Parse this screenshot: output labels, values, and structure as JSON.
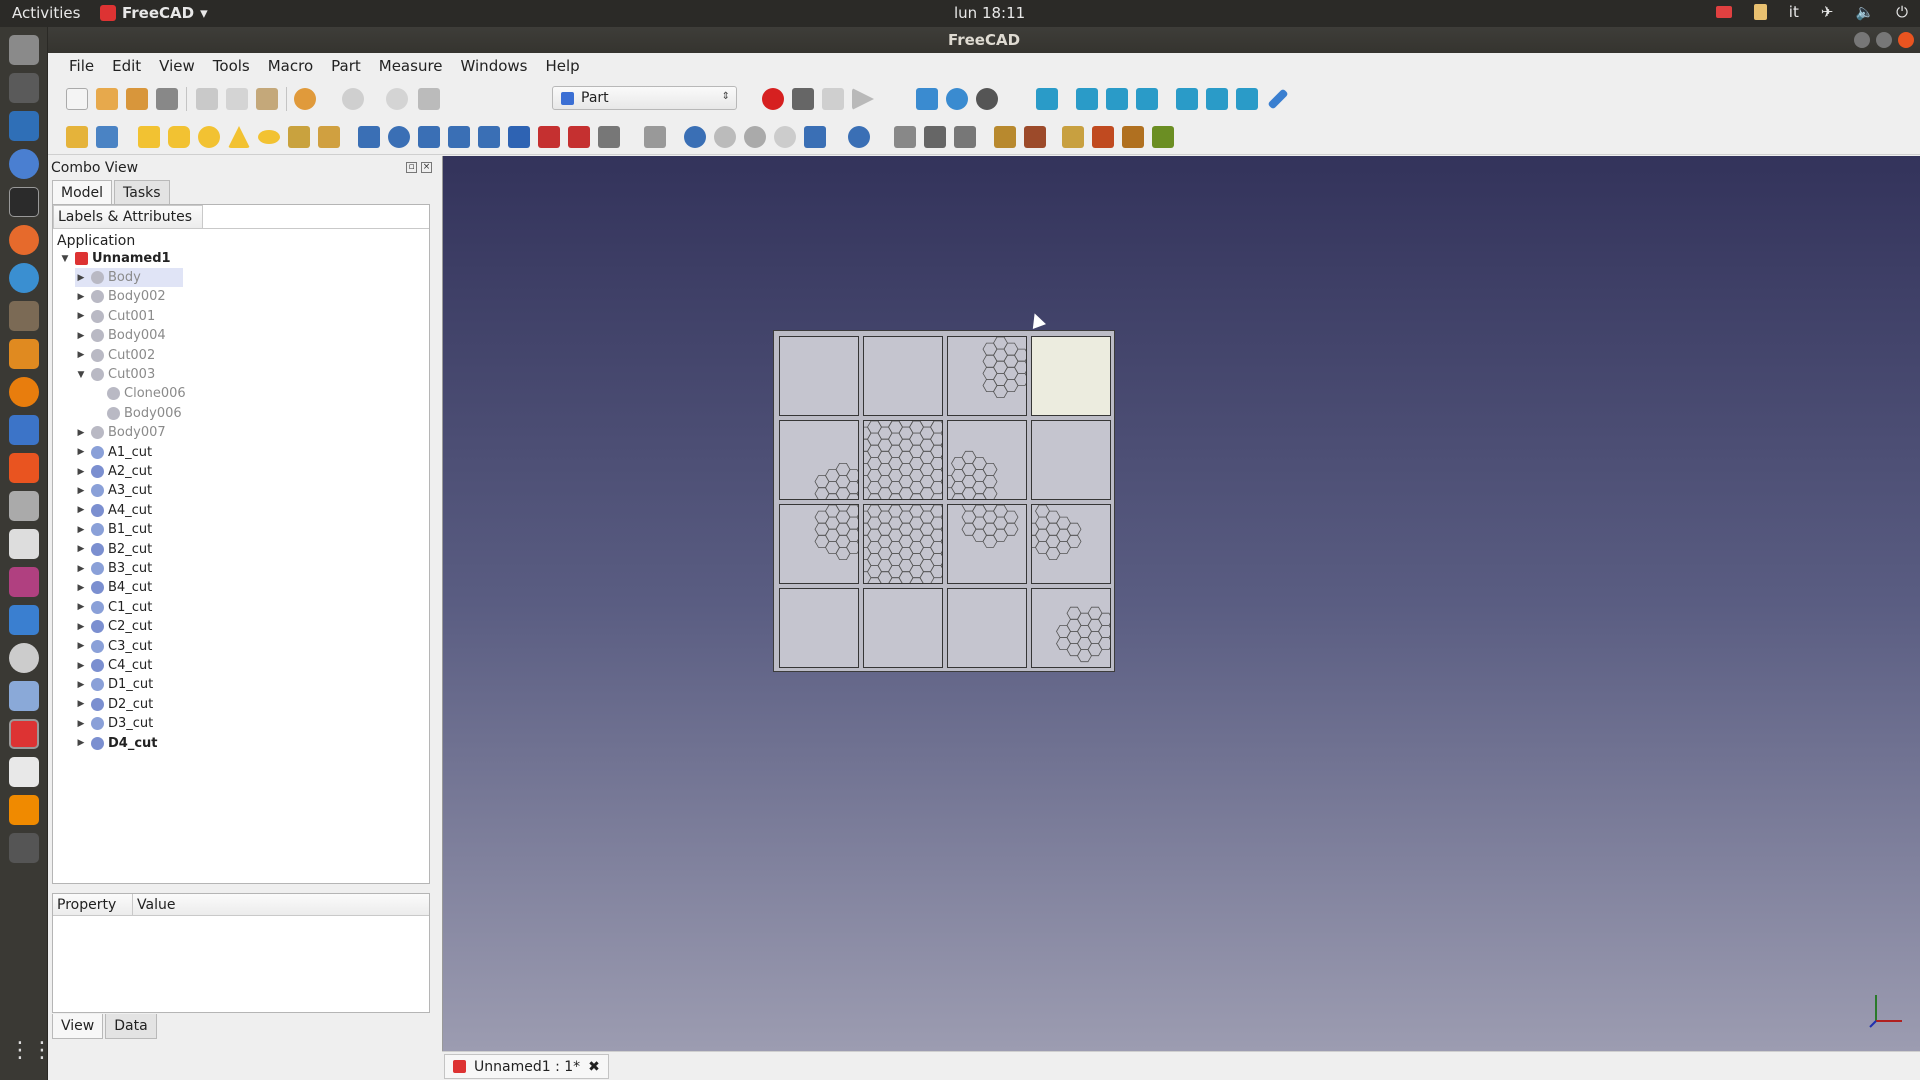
{
  "topbar": {
    "activities": "Activities",
    "app_name": "FreeCAD",
    "clock": "lun 18:11",
    "keyboard_layout": "it"
  },
  "window": {
    "title": "FreeCAD"
  },
  "menubar": [
    "File",
    "Edit",
    "View",
    "Tools",
    "Macro",
    "Part",
    "Measure",
    "Windows",
    "Help"
  ],
  "workbench": {
    "selected": "Part"
  },
  "combo": {
    "title": "Combo View",
    "tabs": [
      "Model",
      "Tasks"
    ],
    "tree_header": "Labels & Attributes",
    "tree_root": "Application",
    "document": "Unnamed1",
    "items": [
      {
        "label": "Body",
        "hidden": true,
        "expanded": false
      },
      {
        "label": "Body002",
        "hidden": true,
        "expanded": false
      },
      {
        "label": "Cut001",
        "hidden": true,
        "expanded": false
      },
      {
        "label": "Body004",
        "hidden": true,
        "expanded": false
      },
      {
        "label": "Cut002",
        "hidden": true,
        "expanded": false
      },
      {
        "label": "Cut003",
        "hidden": true,
        "expanded": true
      },
      {
        "label": "Clone006",
        "hidden": true,
        "child": true
      },
      {
        "label": "Body006",
        "hidden": true,
        "child": true
      },
      {
        "label": "Body007",
        "hidden": true,
        "expanded": false
      },
      {
        "label": "A1_cut",
        "expanded": false
      },
      {
        "label": "A2_cut",
        "expanded": false
      },
      {
        "label": "A3_cut",
        "expanded": false
      },
      {
        "label": "A4_cut",
        "expanded": false
      },
      {
        "label": "B1_cut",
        "expanded": false
      },
      {
        "label": "B2_cut",
        "expanded": false
      },
      {
        "label": "B3_cut",
        "expanded": false
      },
      {
        "label": "B4_cut",
        "expanded": false
      },
      {
        "label": "C1_cut",
        "expanded": false
      },
      {
        "label": "C2_cut",
        "expanded": false
      },
      {
        "label": "C3_cut",
        "expanded": false
      },
      {
        "label": "C4_cut",
        "expanded": false
      },
      {
        "label": "D1_cut",
        "expanded": false
      },
      {
        "label": "D2_cut",
        "expanded": false
      },
      {
        "label": "D3_cut",
        "expanded": false
      },
      {
        "label": "D4_cut",
        "expanded": false,
        "bold": true
      }
    ],
    "property_headers": [
      "Property",
      "Value"
    ],
    "property_tabs": [
      "View",
      "Data"
    ]
  },
  "document_tab": {
    "label": "Unnamed1 : 1*"
  },
  "colors": {
    "accent": "#e95420",
    "selected_cell": "#ececdf",
    "cell": "#c5c5cf",
    "view_top": "#33335b",
    "view_bottom": "#9c9cb1"
  }
}
